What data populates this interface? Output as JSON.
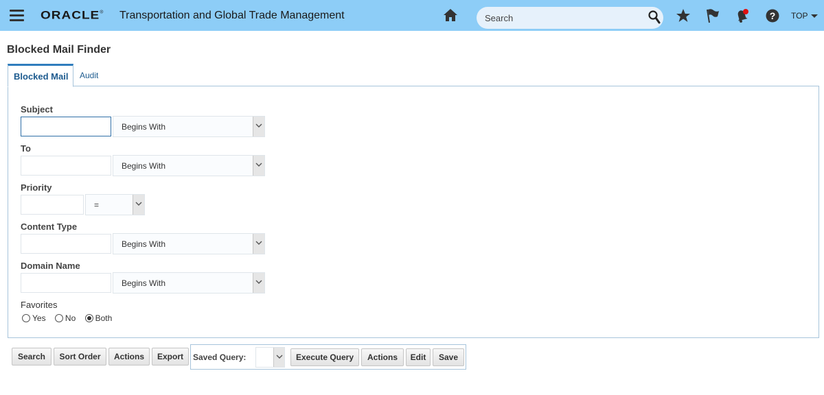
{
  "header": {
    "logo_text": "ORACLE",
    "logo_reg": "®",
    "app_title": "Transportation and Global Trade Management",
    "search_placeholder": "Search",
    "user_menu": "TOP",
    "icons": [
      "menu-icon",
      "home-icon",
      "search-icon",
      "star-icon",
      "flag-icon",
      "notification-bell-icon",
      "help-icon"
    ],
    "accent_color": "#8dcdf7",
    "notification_dot_color": "#e01010"
  },
  "page": {
    "title": "Blocked Mail Finder"
  },
  "tabs": [
    {
      "label": "Blocked Mail",
      "active": true
    },
    {
      "label": "Audit",
      "active": false
    }
  ],
  "form": {
    "subject": {
      "label": "Subject",
      "value": "",
      "operator": "Begins With"
    },
    "to": {
      "label": "To",
      "value": "",
      "operator": "Begins With"
    },
    "priority": {
      "label": "Priority",
      "value": "",
      "operator": "="
    },
    "content_type": {
      "label": "Content Type",
      "value": "",
      "operator": "Begins With"
    },
    "domain_name": {
      "label": "Domain Name",
      "value": "",
      "operator": "Begins With"
    },
    "favorites": {
      "label": "Favorites",
      "options": [
        "Yes",
        "No",
        "Both"
      ],
      "selected": "Both"
    }
  },
  "toolbar": {
    "search": "Search",
    "sort_order": "Sort Order",
    "actions": "Actions",
    "export": "Export",
    "saved_query_label": "Saved Query:",
    "saved_query_value": "",
    "execute_query": "Execute Query",
    "actions2": "Actions",
    "edit": "Edit",
    "save": "Save"
  }
}
